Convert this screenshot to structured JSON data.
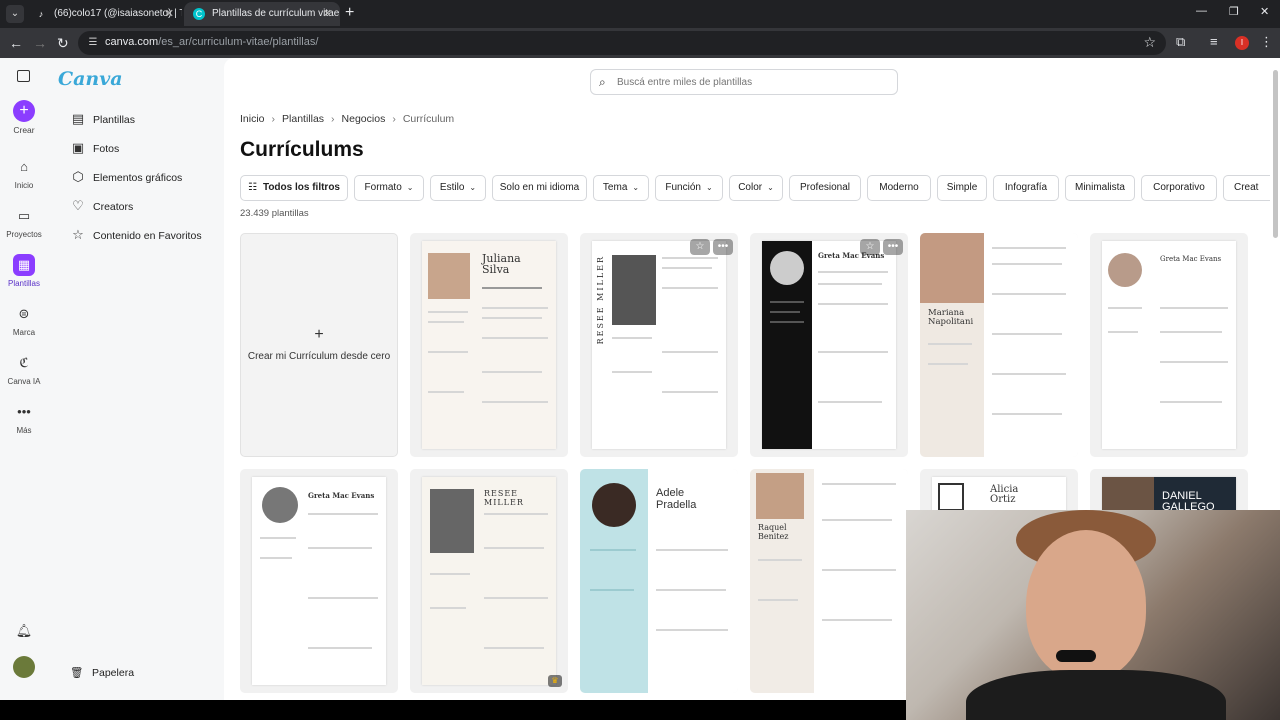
{
  "browser": {
    "tabs": [
      {
        "title": "(66)colo17 (@isaiasoneto) | TikT",
        "favicon": "tiktok-icon"
      },
      {
        "title": "Plantillas de currículum vitae p",
        "favicon": "canva-icon",
        "active": true
      }
    ],
    "url_host": "canva.com",
    "url_path": "/es_ar/curriculum-vitae/plantillas/",
    "profile_initial": "I"
  },
  "rail": {
    "create": "Crear",
    "items": [
      {
        "label": "Inicio",
        "icon": "home-icon"
      },
      {
        "label": "Proyectos",
        "icon": "folder-icon"
      },
      {
        "label": "Plantillas",
        "icon": "templates-icon",
        "active": true
      },
      {
        "label": "Marca",
        "icon": "brand-icon"
      },
      {
        "label": "Canva IA",
        "icon": "ai-icon"
      },
      {
        "label": "Más",
        "icon": "more-icon"
      }
    ]
  },
  "sidebar": {
    "logo": "Canva",
    "items": [
      {
        "label": "Plantillas",
        "icon": "template-icon"
      },
      {
        "label": "Fotos",
        "icon": "photo-icon"
      },
      {
        "label": "Elementos gráficos",
        "icon": "shapes-icon"
      },
      {
        "label": "Creators",
        "icon": "heart-icon"
      },
      {
        "label": "Contenido en Favoritos",
        "icon": "star-icon"
      }
    ],
    "trash": "Papelera"
  },
  "search": {
    "placeholder": "Buscá entre miles de plantillas"
  },
  "breadcrumb": [
    "Inicio",
    "Plantillas",
    "Negocios",
    "Currículum"
  ],
  "page_title": "Currículums",
  "filters": {
    "all": "Todos los filtros",
    "dropdowns": [
      "Formato",
      "Estilo"
    ],
    "lang": "Solo en mi idioma",
    "dropdowns2": [
      "Tema",
      "Función",
      "Color"
    ],
    "chips": [
      "Profesional",
      "Moderno",
      "Simple",
      "Infografía",
      "Minimalista",
      "Corporativo",
      "Creat"
    ]
  },
  "count": "23.439 plantillas",
  "blank_card": {
    "plus": "+",
    "label": "Crear mi Currículum desde cero"
  },
  "templates_row1": [
    {
      "name": "Juliana\nSilva",
      "style": "beige"
    },
    {
      "name": "RESEE MILLER",
      "style": "vertical"
    },
    {
      "name": "Greta Mac Evans",
      "style": "dark"
    },
    {
      "name": "Mariana\nNapolitani",
      "style": "side-photo"
    },
    {
      "name": "Greta Mac Evans",
      "style": "light-round"
    }
  ],
  "templates_row2": [
    {
      "name": "Greta Mac Evans",
      "style": "plain"
    },
    {
      "name": "RESEE MILLER",
      "style": "square-photo"
    },
    {
      "name": "Adele\nPradella",
      "style": "teal"
    },
    {
      "name": "Raquel\nBenitez",
      "style": "side-photo2"
    },
    {
      "name": "Alicia\nOrtiz",
      "style": "frame"
    },
    {
      "name": "DANIEL\nGALLEGO",
      "style": "dark-top"
    }
  ]
}
